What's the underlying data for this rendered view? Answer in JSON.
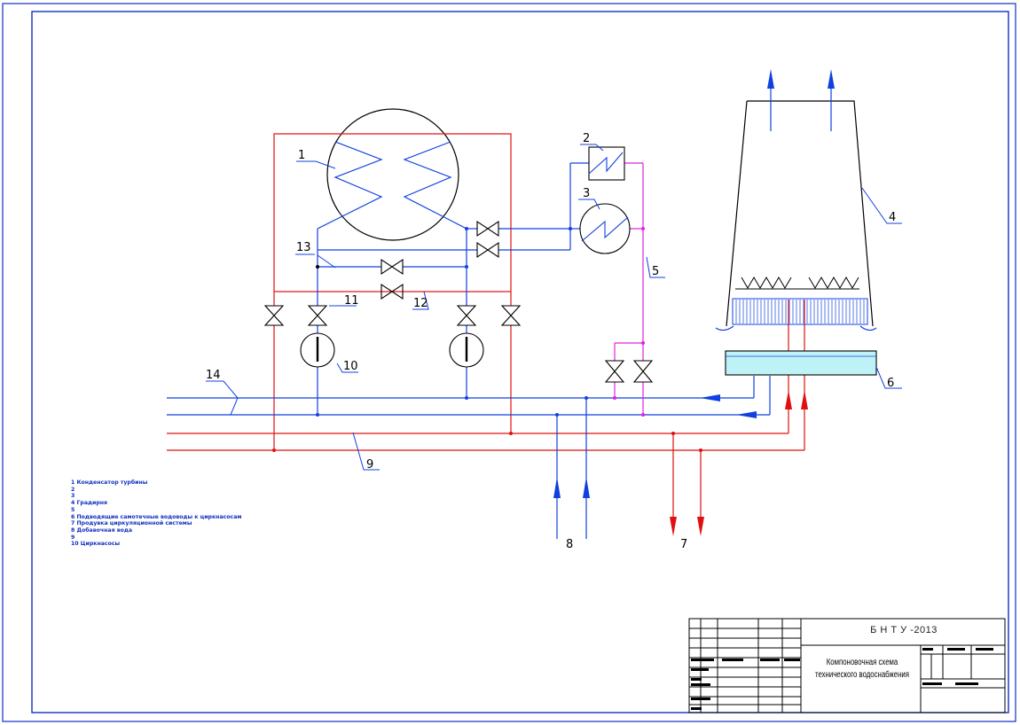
{
  "numbers": {
    "n1": "1",
    "n2": "2",
    "n3": "3",
    "n4": "4",
    "n5": "5",
    "n6": "6",
    "n7": "7",
    "n8": "8",
    "n9": "9",
    "n10": "10",
    "n11": "11",
    "n12": "12",
    "n13": "13",
    "n14": "14"
  },
  "legend": [
    "1 Конденсатор турбины",
    "2",
    "3",
    "4 Градирня",
    "5",
    "6 Подводящие самотечные водоводы к циркнасосам",
    "7 Продувка циркуляционной системы",
    "8 Добавочная вода",
    "9",
    "10 Циркнасосы"
  ],
  "stamp": {
    "organization": "Б Н Т У -2013",
    "title": "Компоновочная схема технического водоснабжения"
  },
  "colors": {
    "frame": "#1030c0",
    "cold_water": "#1040e0",
    "hot_water": "#e01010",
    "auxiliary": "#e020e0",
    "basin_fill": "#bff2f6",
    "outline": "#000000"
  },
  "icons": [
    "valve-icon",
    "pump-icon",
    "heat-exchanger-icon",
    "flow-arrow-icon"
  ]
}
